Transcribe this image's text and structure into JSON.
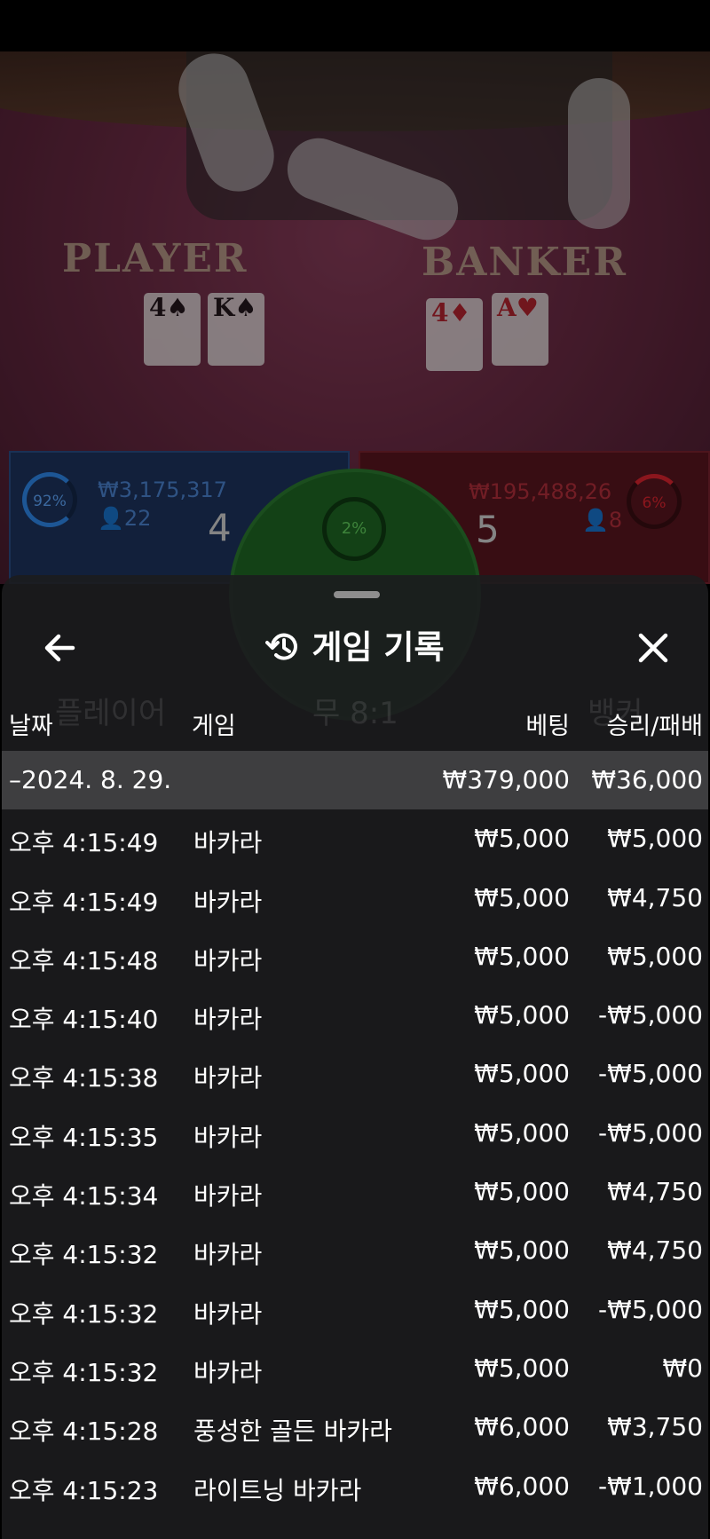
{
  "video": {
    "player_label": "PLAYER",
    "banker_label": "BANKER",
    "player_cards": [
      {
        "rank": "4",
        "suit": "♠",
        "color": "black"
      },
      {
        "rank": "K",
        "suit": "♠",
        "color": "black"
      }
    ],
    "banker_cards": [
      {
        "rank": "4",
        "suit": "♦",
        "color": "red"
      },
      {
        "rank": "A",
        "suit": "♥",
        "color": "red"
      }
    ]
  },
  "scoreboard": {
    "player_pct": "92%",
    "player_amount": "₩3,175,317",
    "player_users": "22",
    "player_score": "4",
    "tie_pct": "2%",
    "banker_amount": "₩195,488,26",
    "banker_users": "8",
    "banker_score": "5",
    "banker_pct": "6%"
  },
  "sheet": {
    "title": "게임 기록",
    "columns": {
      "date": "날짜",
      "game": "게임",
      "bet": "베팅",
      "winloss": "승리/패배"
    },
    "date_row": {
      "date": "–2024. 8. 29.",
      "bet": "₩379,000",
      "winloss": "₩36,000"
    },
    "rows": [
      {
        "time": "오후 4:15:49",
        "game": "바카라",
        "bet": "₩5,000",
        "winloss": "₩5,000"
      },
      {
        "time": "오후 4:15:49",
        "game": "바카라",
        "bet": "₩5,000",
        "winloss": "₩4,750"
      },
      {
        "time": "오후 4:15:48",
        "game": "바카라",
        "bet": "₩5,000",
        "winloss": "₩5,000"
      },
      {
        "time": "오후 4:15:40",
        "game": "바카라",
        "bet": "₩5,000",
        "winloss": "-₩5,000"
      },
      {
        "time": "오후 4:15:38",
        "game": "바카라",
        "bet": "₩5,000",
        "winloss": "-₩5,000"
      },
      {
        "time": "오후 4:15:35",
        "game": "바카라",
        "bet": "₩5,000",
        "winloss": "-₩5,000"
      },
      {
        "time": "오후 4:15:34",
        "game": "바카라",
        "bet": "₩5,000",
        "winloss": "₩4,750"
      },
      {
        "time": "오후 4:15:32",
        "game": "바카라",
        "bet": "₩5,000",
        "winloss": "₩4,750"
      },
      {
        "time": "오후 4:15:32",
        "game": "바카라",
        "bet": "₩5,000",
        "winloss": "-₩5,000"
      },
      {
        "time": "오후 4:15:32",
        "game": "바카라",
        "bet": "₩5,000",
        "winloss": "₩0"
      },
      {
        "time": "오후 4:15:28",
        "game": "풍성한 골든 바카라",
        "bet": "₩6,000",
        "winloss": "₩3,750"
      },
      {
        "time": "오후 4:15:23",
        "game": "라이트닝 바카라",
        "bet": "₩6,000",
        "winloss": "-₩1,000"
      }
    ]
  },
  "colors": {
    "sheet_bg": "#1c1c1e",
    "date_row_bg": "#3e3e40",
    "text": "#ffffff",
    "player_blue": "#1d3560",
    "banker_red": "#5b1620",
    "tie_green": "#1f6a25"
  },
  "icons": {
    "back": "arrow-left-icon",
    "history": "history-clock-icon",
    "close": "close-x-icon",
    "user": "user-icon"
  }
}
